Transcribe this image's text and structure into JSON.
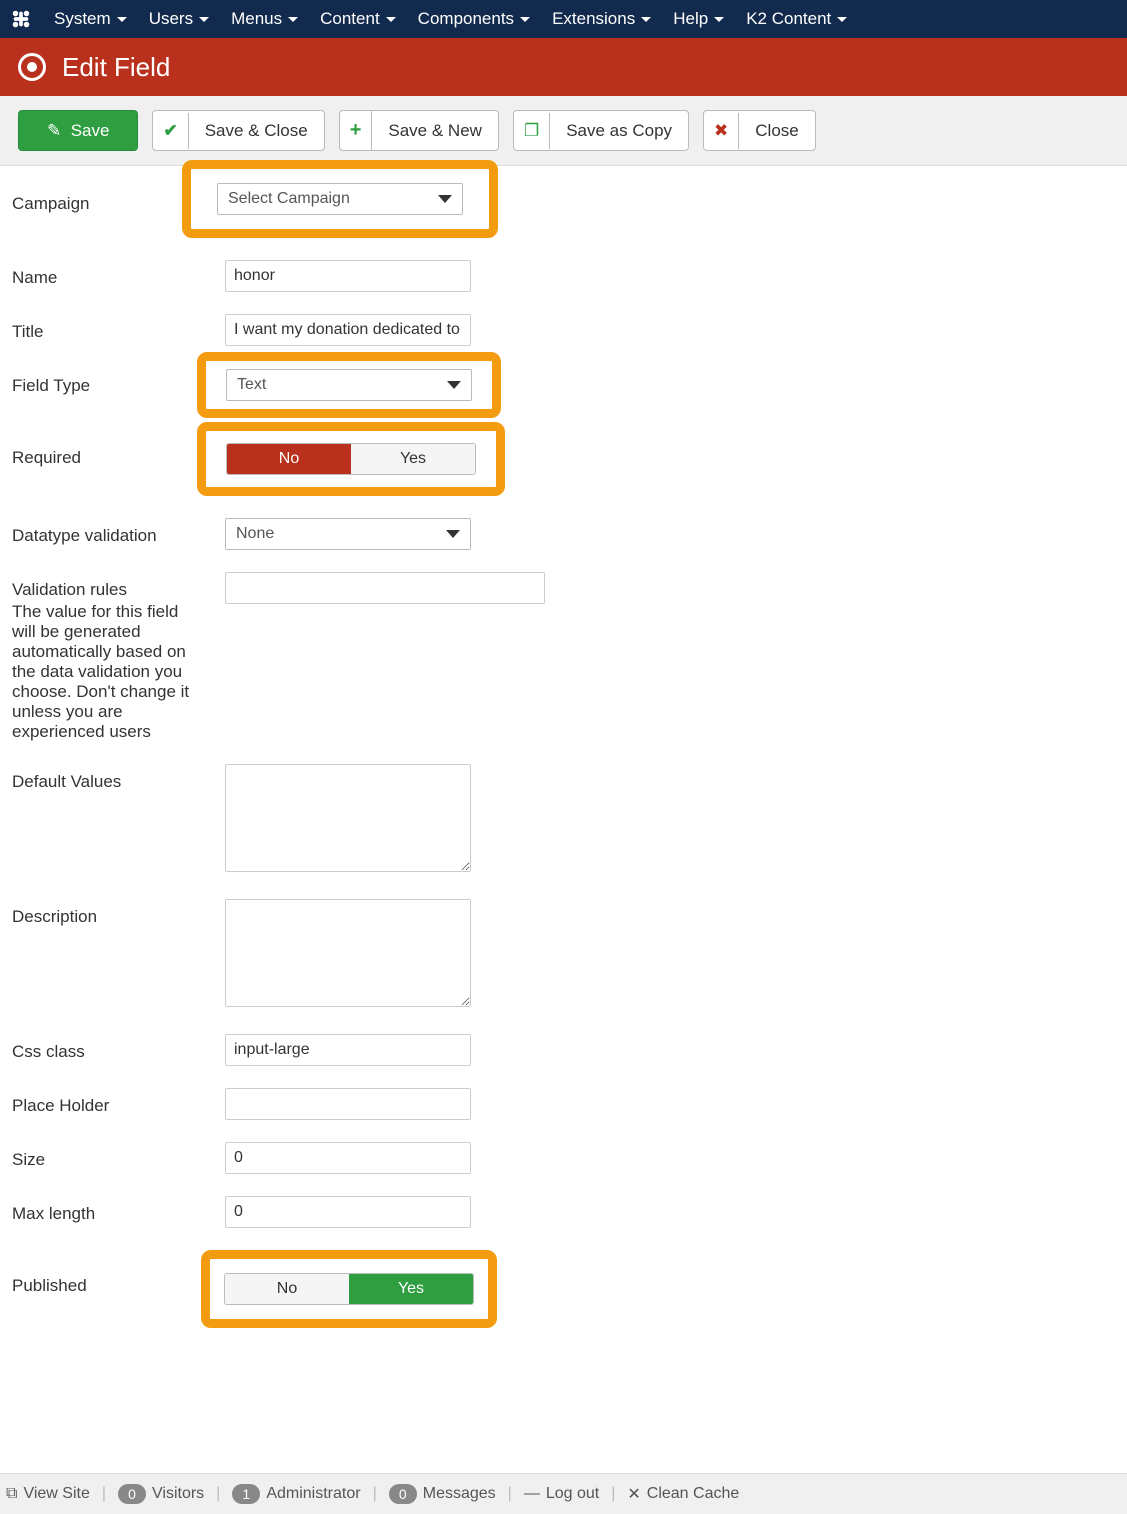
{
  "menu": {
    "items": [
      "System",
      "Users",
      "Menus",
      "Content",
      "Components",
      "Extensions",
      "Help",
      "K2 Content"
    ]
  },
  "header": {
    "title": "Edit Field"
  },
  "toolbar": {
    "save": "Save",
    "save_close": "Save & Close",
    "save_new": "Save & New",
    "save_copy": "Save as Copy",
    "close": "Close"
  },
  "form": {
    "campaign": {
      "label": "Campaign",
      "value": "Select Campaign"
    },
    "name": {
      "label": "Name",
      "value": "honor"
    },
    "title": {
      "label": "Title",
      "value": "I want my donation dedicated to (In honor of)"
    },
    "field_type": {
      "label": "Field Type",
      "value": "Text"
    },
    "required": {
      "label": "Required",
      "no": "No",
      "yes": "Yes",
      "value": "No"
    },
    "datatype": {
      "label": "Datatype validation",
      "value": "None"
    },
    "validation": {
      "label": "Validation rules",
      "hint": "The value for this field will be generated automatically based on the data validation you choose. Don't change it unless you are experienced users",
      "value": ""
    },
    "default_values": {
      "label": "Default Values",
      "value": ""
    },
    "description": {
      "label": "Description",
      "value": ""
    },
    "css_class": {
      "label": "Css class",
      "value": "input-large"
    },
    "placeholder": {
      "label": "Place Holder",
      "value": ""
    },
    "size": {
      "label": "Size",
      "value": "0"
    },
    "max_length": {
      "label": "Max length",
      "value": "0"
    },
    "published": {
      "label": "Published",
      "no": "No",
      "yes": "Yes",
      "value": "Yes"
    }
  },
  "statusbar": {
    "view_site": "View Site",
    "visitors": {
      "count": "0",
      "label": "Visitors"
    },
    "administrator": {
      "count": "1",
      "label": "Administrator"
    },
    "messages": {
      "count": "0",
      "label": "Messages"
    },
    "logout": "Log out",
    "clean_cache": "Clean Cache"
  }
}
